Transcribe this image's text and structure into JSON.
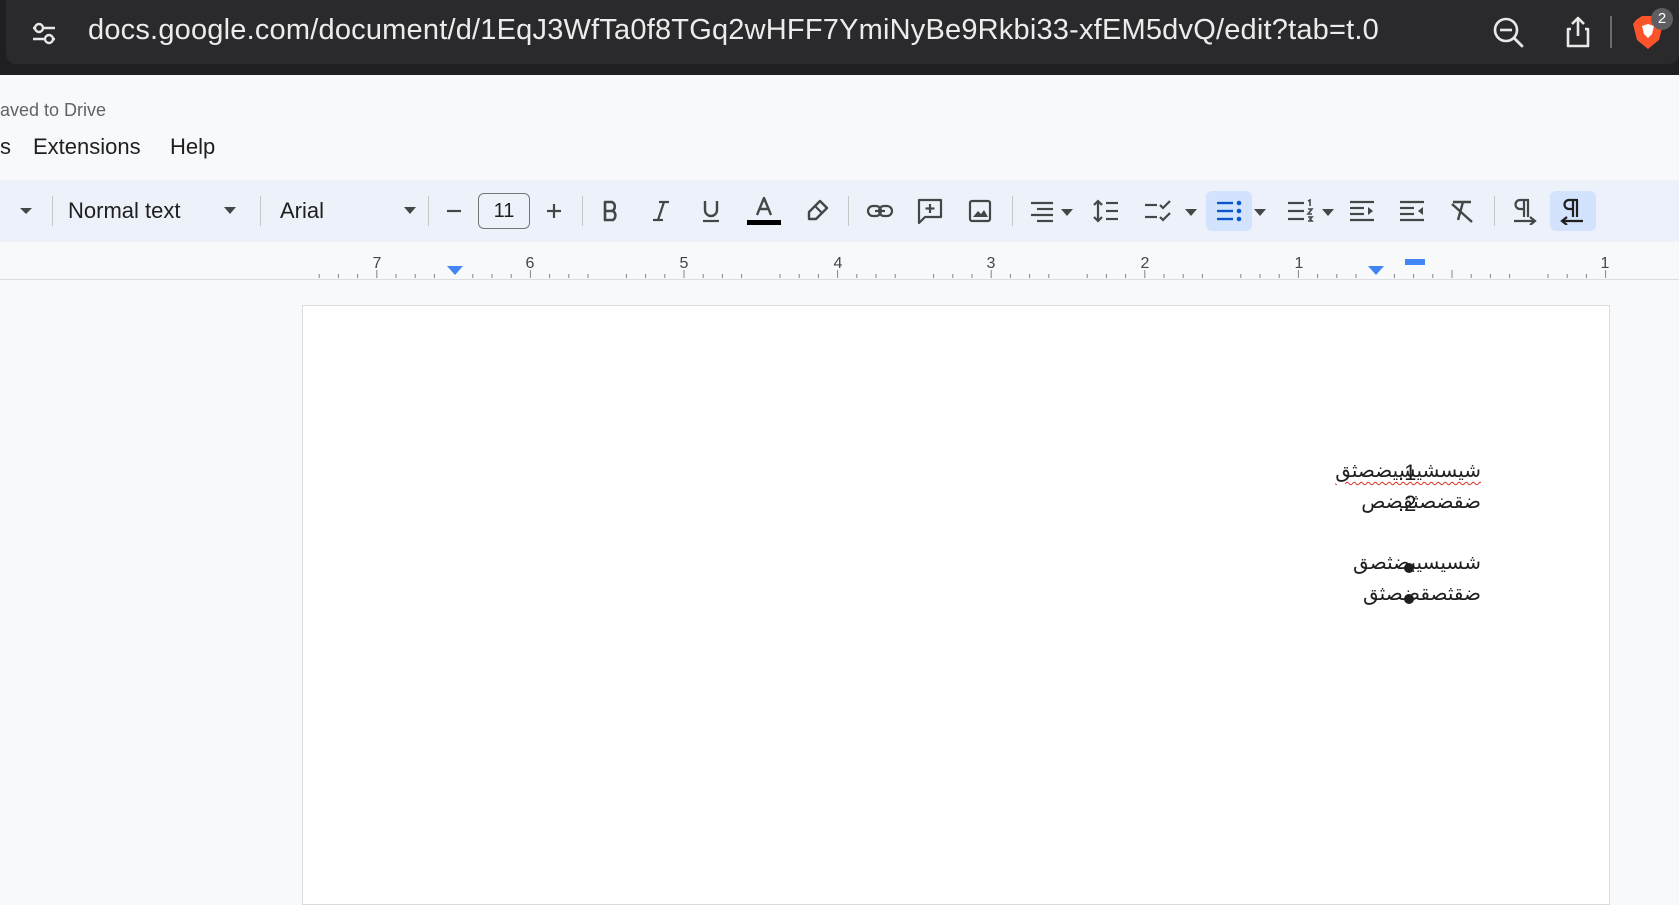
{
  "browser": {
    "url": "docs.google.com/document/d/1EqJ3WfTa0f8TGq2wHFF7YmiNyBe9Rkbi33-xfEM5dvQ/edit?tab=t.0",
    "brave_badge_count": "2",
    "icons": [
      "site-info-icon",
      "zoom-out-icon",
      "share-icon",
      "brave-shield-icon"
    ]
  },
  "docs": {
    "saved_status": "aved to Drive",
    "menu": [
      "s",
      "Extensions",
      "Help"
    ]
  },
  "toolbar": {
    "paragraph_style": "Normal text",
    "font_family": "Arial",
    "font_size": "11",
    "icons": [
      "more-dropdown-icon",
      "decrease-font-size-icon",
      "increase-font-size-icon",
      "bold-icon",
      "italic-icon",
      "underline-icon",
      "text-color-icon",
      "highlight-icon",
      "insert-link-icon",
      "add-comment-icon",
      "insert-image-icon",
      "align-icon",
      "line-spacing-icon",
      "checklist-icon",
      "bulleted-list-icon",
      "numbered-list-icon",
      "decrease-indent-icon",
      "increase-indent-icon",
      "clear-formatting-icon",
      "ltr-icon",
      "rtl-icon"
    ],
    "active": [
      "bulleted-list",
      "right-to-left"
    ],
    "text_color": "#000000",
    "active_bg": "#d3e3fd"
  },
  "ruler": {
    "labels": [
      "7",
      "6",
      "5",
      "4",
      "3",
      "2",
      "1",
      "1"
    ]
  },
  "document": {
    "numbered_list": [
      {
        "marker": "1.",
        "text": "شيسشيسيضصثق",
        "misspelled": true
      },
      {
        "marker": "2.",
        "text": "ضقضصثقضص",
        "misspelled": false
      }
    ],
    "bulleted_list": [
      {
        "text": "شسيسيبضثصق"
      },
      {
        "text": "ضقثصقضصثق"
      }
    ]
  }
}
